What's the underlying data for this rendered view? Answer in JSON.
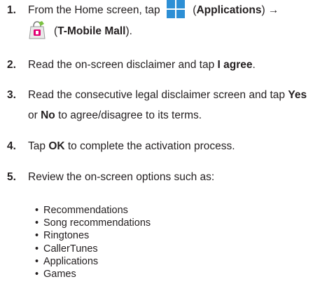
{
  "steps": [
    {
      "number": "1.",
      "part1": "From the Home screen, tap ",
      "icon1": "applications-icon",
      "part2": " (",
      "bold1": "Applications",
      "part3": ") →",
      "icon2": "t-mobile-mall-icon",
      "part4": " (",
      "bold2": "T-Mobile Mall",
      "part5": ")."
    },
    {
      "number": "2.",
      "text": "Read the on-screen disclaimer and tap ",
      "bold": "I agree",
      "end": "."
    },
    {
      "number": "3.",
      "line1_text": "Read the consecutive legal disclaimer screen and tap ",
      "line1_bold": "Yes",
      "line2_text": "or ",
      "line2_bold": "No",
      "line2_end": " to agree/disagree to its terms."
    },
    {
      "number": "4.",
      "text_a": "Tap ",
      "bold": "OK",
      "text_b": " to complete the activation process."
    },
    {
      "number": "5.",
      "text": "Review the on-screen options such as:"
    }
  ],
  "bullet_symbol": "•",
  "options": [
    "Recommendations",
    "Song recommendations",
    "Ringtones",
    "CallerTunes",
    "Applications",
    "Games"
  ],
  "colors": {
    "text": "#231f20",
    "apps_icon": "#2d8fd5",
    "mall_icon_bag": "#e5e5e5",
    "mall_icon_accent": "#e20074"
  }
}
